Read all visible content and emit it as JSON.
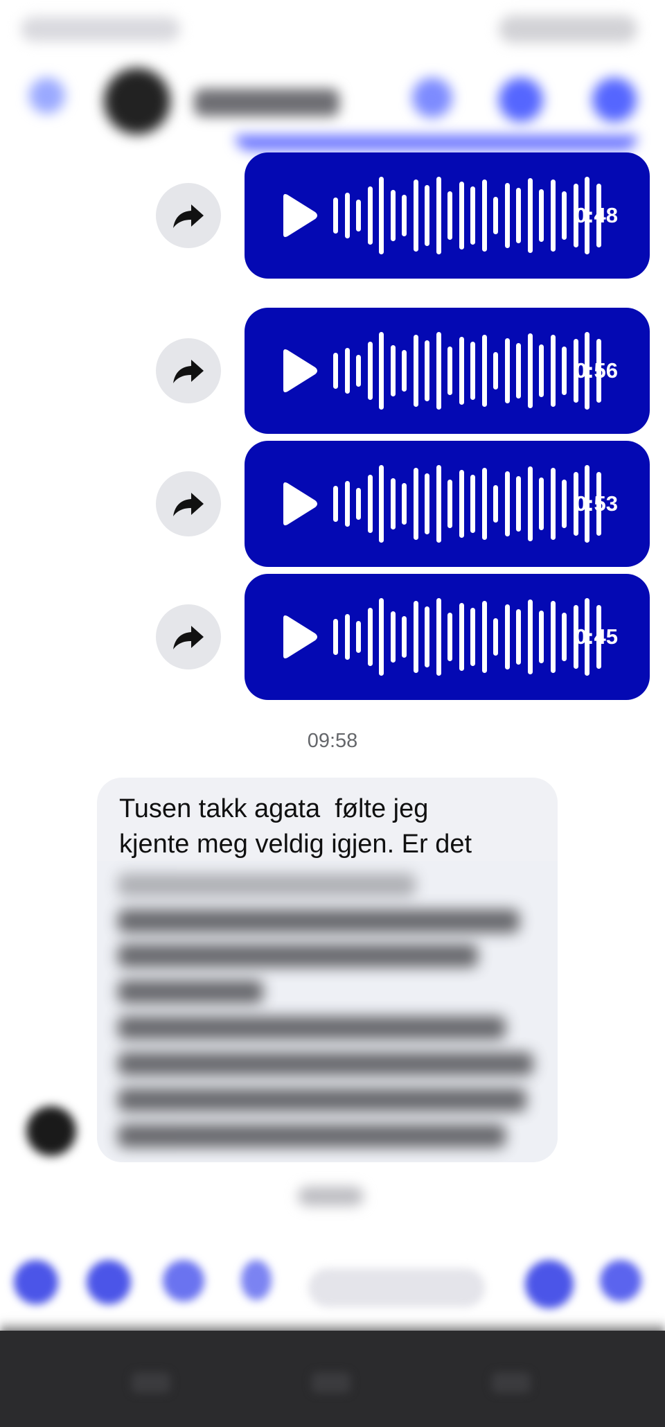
{
  "header": {
    "back_icon": "back-arrow-icon",
    "contact_name": "",
    "actions": [
      "phone-icon",
      "video-icon",
      "info-icon"
    ]
  },
  "voice_messages": [
    {
      "duration": "0:48",
      "play_icon": "play-icon",
      "forward_icon": "forward-icon"
    },
    {
      "duration": "0:56",
      "play_icon": "play-icon",
      "forward_icon": "forward-icon"
    },
    {
      "duration": "0:53",
      "play_icon": "play-icon",
      "forward_icon": "forward-icon"
    },
    {
      "duration": "0:45",
      "play_icon": "play-icon",
      "forward_icon": "forward-icon"
    }
  ],
  "timestamp": "09:58",
  "incoming_message": {
    "text": "Tusen takk agata  følte jeg\nkjente meg veldig igjen. Er det"
  },
  "composer": {
    "icons": [
      "menu-icon",
      "camera-icon",
      "gallery-icon",
      "mic-icon",
      "emoji-icon",
      "like-icon"
    ]
  },
  "colors": {
    "bubble": "#0409b3",
    "accent": "#5566ff",
    "incoming_bubble": "#f0f1f5"
  }
}
